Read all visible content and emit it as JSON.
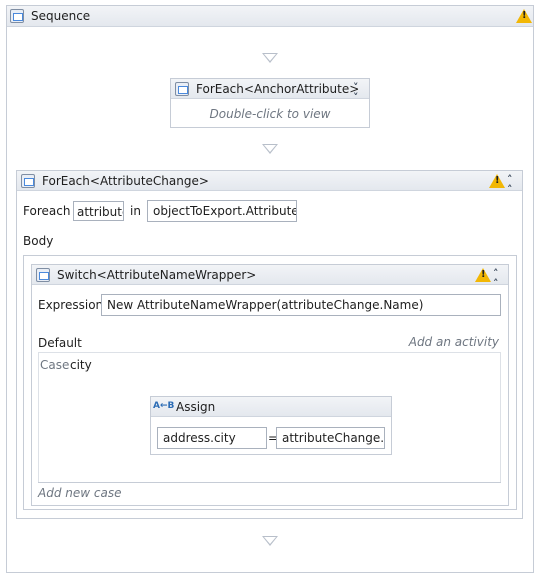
{
  "sequence": {
    "title": "Sequence"
  },
  "foreach_anchor": {
    "title": "ForEach<AnchorAttribute>",
    "hint": "Double-click to view"
  },
  "foreach_change": {
    "title": "ForEach<AttributeChange>",
    "foreach_label": "Foreach",
    "item_value": "attribute",
    "in_label": "in",
    "collection_value": "objectToExport.AttributeC",
    "body_label": "Body"
  },
  "switch": {
    "title": "Switch<AttributeNameWrapper>",
    "expression_label": "Expression",
    "expression_value": "New AttributeNameWrapper(attributeChange.Name)",
    "default_label": "Default",
    "add_activity": "Add an activity",
    "case_label": "Case",
    "case_value": "city",
    "add_case": "Add new case"
  },
  "assign": {
    "title": "Assign",
    "icon_text": "A←B",
    "to_value": "address.city",
    "equals": "=",
    "value": "attributeChange.Va"
  }
}
